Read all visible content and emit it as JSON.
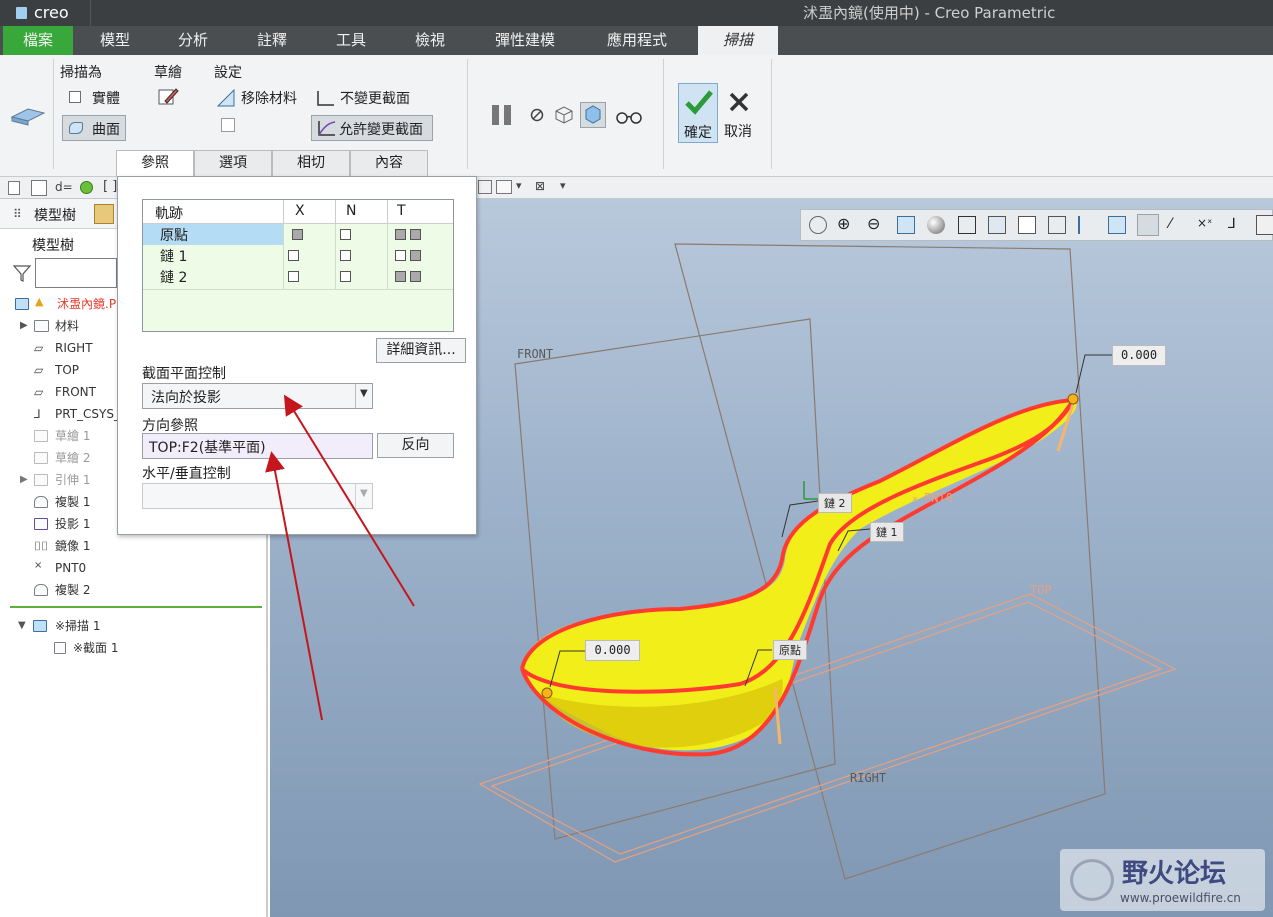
{
  "window": {
    "app_logo": "creo",
    "title": "沭盄內鏡(使用中) - Creo Parametric"
  },
  "menu": {
    "items": [
      "檔案",
      "模型",
      "分析",
      "註釋",
      "工具",
      "檢視",
      "彈性建模",
      "應用程式",
      "掃描"
    ]
  },
  "ribbon": {
    "sweep_as_label": "掃描為",
    "solid_label": "實體",
    "surface_label": "曲面",
    "sketch_label": "草繪",
    "settings_label": "設定",
    "remove_material_label": "移除材料",
    "constant_section_label": "不變更截面",
    "variable_section_label": "允許變更截面",
    "confirm_label": "確定",
    "cancel_label": "取消",
    "subtabs": [
      "參照",
      "選項",
      "相切",
      "內容"
    ]
  },
  "model_tree": {
    "tab_label": "模型樹",
    "header": "模型樹",
    "items": [
      {
        "label": "沭盄內鏡.PRT",
        "icon": "part-icon"
      },
      {
        "label": "材料",
        "icon": "material-icon"
      },
      {
        "label": "RIGHT",
        "icon": "datum-plane-icon"
      },
      {
        "label": "TOP",
        "icon": "datum-plane-icon"
      },
      {
        "label": "FRONT",
        "icon": "datum-plane-icon"
      },
      {
        "label": "PRT_CSYS_DEF",
        "icon": "csys-icon"
      },
      {
        "label": "草繪 1",
        "icon": "sketch-icon"
      },
      {
        "label": "草繪 2",
        "icon": "sketch-icon"
      },
      {
        "label": "引伸 1",
        "icon": "extrude-icon"
      },
      {
        "label": "複製 1",
        "icon": "copy-icon"
      },
      {
        "label": "投影 1",
        "icon": "project-icon"
      },
      {
        "label": "鏡像 1",
        "icon": "mirror-icon"
      },
      {
        "label": "PNT0",
        "icon": "datum-point-icon"
      },
      {
        "label": "複製 2",
        "icon": "copy-icon"
      },
      {
        "label": "※掃描 1",
        "icon": "sweep-icon"
      },
      {
        "label": "※截面 1",
        "icon": "section-icon"
      }
    ]
  },
  "references_panel": {
    "table_headers": [
      "軌跡",
      "X",
      "N",
      "T"
    ],
    "rows": [
      "原點",
      "鏈 1",
      "鏈 2"
    ],
    "details_button": "詳細資訊...",
    "section_plane_label": "截面平面控制",
    "section_plane_value": "法向於投影",
    "direction_ref_label": "方向參照",
    "direction_ref_value": "TOP:F2(基準平面)",
    "flip_button": "反向",
    "hv_control_label": "水平/垂直控制"
  },
  "viewport": {
    "labels": {
      "front": "FRONT",
      "top": "TOP",
      "right": "RIGHT",
      "pnt": "PNT0",
      "chain1": "鏈 1",
      "chain2": "鏈 2",
      "origin": "原點",
      "dim_top": "0.000",
      "dim_left": "0.000"
    },
    "colors": {
      "surface": "#f2ee1a",
      "trajectory": "#ff3b30",
      "plane": "#8c7a70",
      "arrow": "#f5b66a"
    }
  },
  "watermark": {
    "title": "野火论坛",
    "url": "www.proewildfire.cn"
  }
}
